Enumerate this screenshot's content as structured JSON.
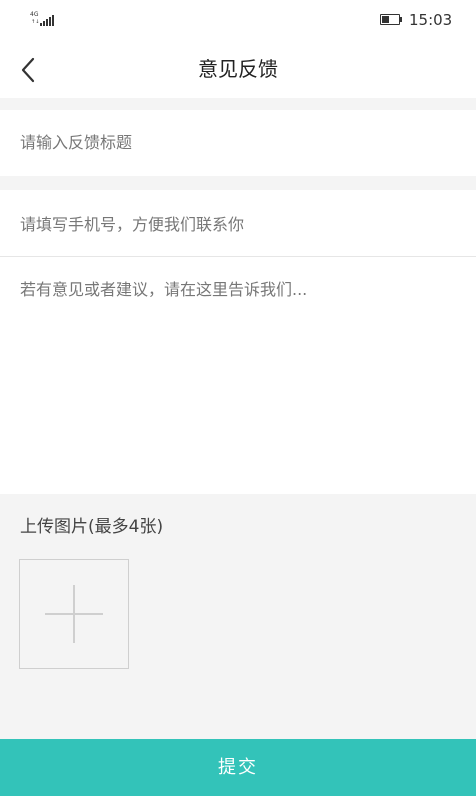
{
  "status_bar": {
    "network": "4G",
    "time": "15:03",
    "battery_level": 0.45
  },
  "nav": {
    "title": "意见反馈",
    "back_icon": "chevron-left-icon"
  },
  "form": {
    "title_placeholder": "请输入反馈标题",
    "phone_placeholder": "请填写手机号，方便我们联系你",
    "content_placeholder": "若有意见或者建议，请在这里告诉我们..."
  },
  "upload": {
    "label": "上传图片(最多4张)",
    "add_icon": "plus-icon"
  },
  "submit": {
    "label": "提交"
  },
  "colors": {
    "accent": "#33c3b9",
    "page_background": "#f4f4f4",
    "placeholder_text": "#777777"
  }
}
